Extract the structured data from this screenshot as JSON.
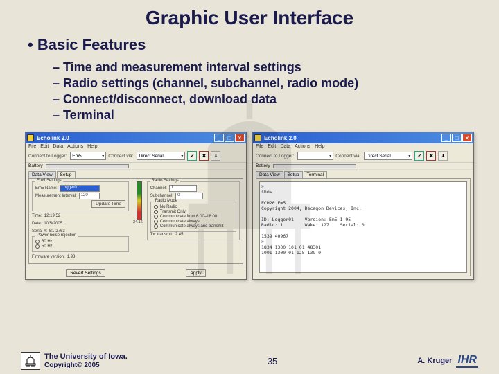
{
  "slide": {
    "title": "Graphic User Interface",
    "bullet_main": "Basic Features",
    "sub_bullets": [
      "Time and measurement interval settings",
      "Radio settings (channel, subchannel, radio mode)",
      "Connect/disconnect, download data",
      "Terminal"
    ],
    "page_number": "35",
    "footer_left_line1": "The University of Iowa.",
    "footer_left_line2": "Copyright© 2005",
    "footer_author": "A. Kruger",
    "footer_right_logo": "IHR"
  },
  "window1": {
    "title": "Echolink 2.0",
    "menu": [
      "File",
      "Edit",
      "Data",
      "Actions",
      "Help"
    ],
    "toolbar": {
      "conn_label": "Connect to Logger:",
      "conn_sel": "Em5",
      "via_label": "Connect via:",
      "via_sel": "Direct Serial"
    },
    "battery_label": "Battery",
    "tabs": [
      "Data View",
      "Setup"
    ],
    "em5": {
      "legend": "Em5 Settings",
      "name_label": "Em5 Name:",
      "name_value": "Logger01",
      "interval_label": "Measurement Interval:",
      "interval_value": "120",
      "update_btn": "Update Time"
    },
    "info": {
      "time_label": "Time:",
      "time_value": "12:19:52",
      "date_label": "Date:",
      "date_value": "10/5/2005",
      "serial_label": "Serial #:",
      "serial_value": "B1-2763",
      "power_label": "Power noise rejection",
      "opt1": "60 Hz",
      "opt2": "50 Hz",
      "fw_label": "Firmware version:",
      "fw_value": "1.93"
    },
    "radio": {
      "legend": "Radio Settings",
      "channel_label": "Channel:",
      "channel_value": "1",
      "sub_label": "Subchannel:",
      "sub_value": "0",
      "mode_legend": "Radio Mode",
      "opts": [
        "No Radio",
        "Transmit Only",
        "Communicate from 6:00–18:00",
        "Communicate always",
        "Communicate always and transmit"
      ],
      "tx_label": "Tx: transmit:",
      "tx_value": "2.45"
    },
    "buttons": {
      "revert": "Revert Settings",
      "apply": "Apply"
    },
    "gauge_label": "24.16"
  },
  "window2": {
    "title": "Echolink 2.0",
    "menu": [
      "File",
      "Edit",
      "Data",
      "Actions",
      "Help"
    ],
    "toolbar": {
      "conn_label": "Connect to Logger:",
      "via_label": "Connect via:",
      "via_sel": "Direct Serial"
    },
    "battery_label": "Battery",
    "tabs": [
      "Data View",
      "Setup",
      "Terminal"
    ],
    "terminal_text": ">\nshow\n\nECH20 Em5\nCopyright 2004, Decagon Devices, Inc.\n\nID: Logger01    Version: Em5 1.95\nRadio: 1        Wake: 127    Serial: 0\n\n1539 40967\n>\n1834 1300 101 01 48301\n1001 1300 01 125 139 0"
  }
}
